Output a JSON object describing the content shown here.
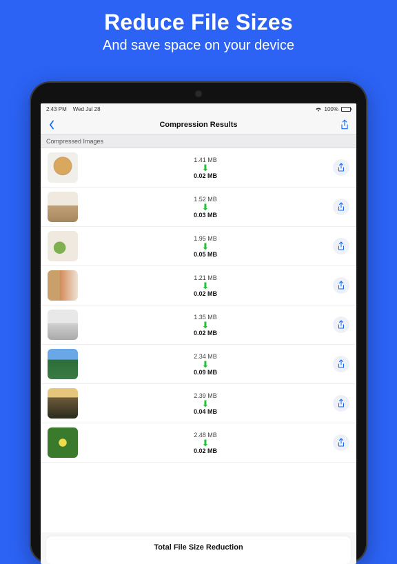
{
  "hero": {
    "title": "Reduce File Sizes",
    "subtitle": "And save space on your device"
  },
  "status": {
    "time": "2:43 PM",
    "date": "Wed Jul 28",
    "battery": "100%"
  },
  "nav": {
    "title": "Compression Results"
  },
  "section": {
    "title": "Compressed Images"
  },
  "rows": [
    {
      "orig": "1.41 MB",
      "comp": "0.02 MB"
    },
    {
      "orig": "1.52 MB",
      "comp": "0.03 MB"
    },
    {
      "orig": "1.95 MB",
      "comp": "0.05 MB"
    },
    {
      "orig": "1.21 MB",
      "comp": "0.02 MB"
    },
    {
      "orig": "1.35 MB",
      "comp": "0.02 MB"
    },
    {
      "orig": "2.34 MB",
      "comp": "0.09 MB"
    },
    {
      "orig": "2.39 MB",
      "comp": "0.04 MB"
    },
    {
      "orig": "2.48 MB",
      "comp": "0.02 MB"
    }
  ],
  "footer": {
    "label": "Total File Size Reduction"
  }
}
